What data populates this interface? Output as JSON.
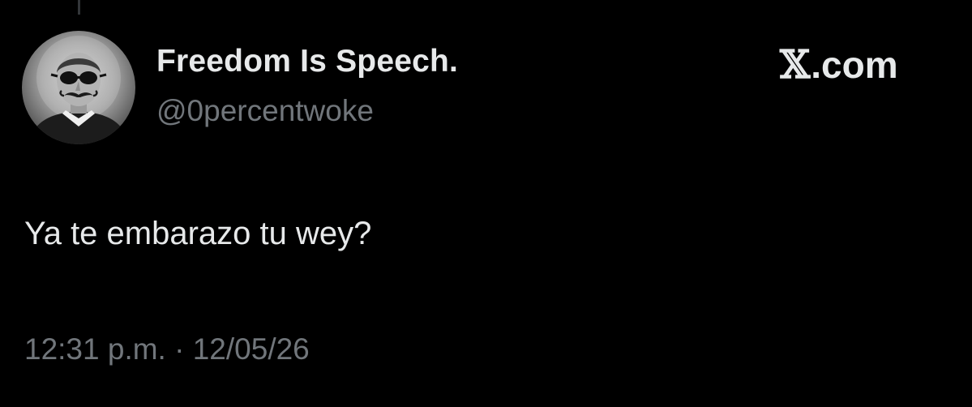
{
  "tweet": {
    "author": {
      "display_name": "Freedom Is Speech.",
      "handle": "@0percentwoke",
      "avatar_icon": "sepia-portrait-mustache-sunglasses-avatar"
    },
    "brand": {
      "logo_letter": "𝕏",
      "domain_suffix": ".com"
    },
    "text": "Ya te embarazo tu wey?",
    "meta": {
      "time": "12:31 p.m.",
      "separator": "·",
      "date": "12/05/26"
    }
  },
  "colors": {
    "background": "#000000",
    "primary_text": "#e7e9ea",
    "secondary_text": "#71767b"
  }
}
